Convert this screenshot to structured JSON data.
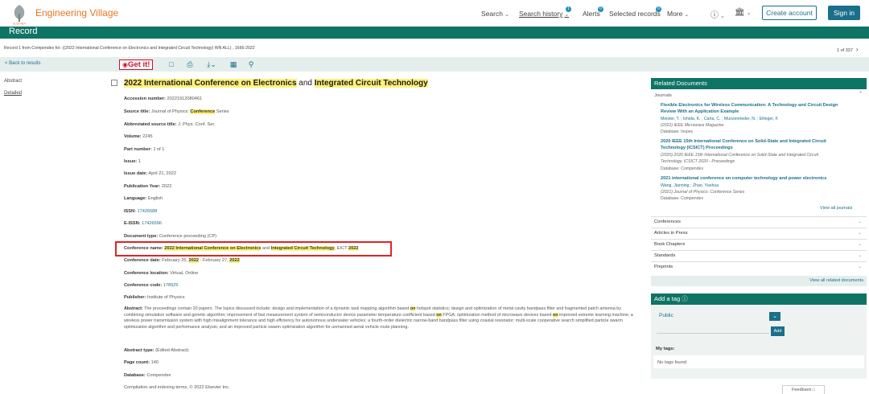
{
  "header": {
    "brand": "Engineering Village",
    "nav": [
      {
        "label": "Search"
      },
      {
        "label": "Search history",
        "badge": "1"
      },
      {
        "label": "Alerts",
        "badge": "0"
      },
      {
        "label": "Selected records",
        "badge": "0"
      },
      {
        "label": "More"
      }
    ],
    "create_account": "Create account",
    "sign_in": "Sign in"
  },
  "page": {
    "title": "Record",
    "record_line": "Record 1 from Compendex for: ((2022 International Conference on Electronics and Integrated Circuit Technology) WN ALL) , 1666-2022",
    "record_count": "1 of 337"
  },
  "toolbar": {
    "back": "< Back to results",
    "getit": "Get it!"
  },
  "sidenav": {
    "abstract": "Abstract",
    "detailed": "Detailed"
  },
  "record": {
    "title_a": "2022 International Conference on Electronics",
    "title_and": " and ",
    "title_b": "Integrated Circuit Technology",
    "accession_label": "Accession number:",
    "accession": "20221912080461",
    "source_label": "Source title:",
    "source_pre": "Journal of Physics: ",
    "source_hl": "Conference",
    "source_post": " Series",
    "abbrev_label": "Abbreviated source title:",
    "abbrev": "J. Phys. Conf. Ser.",
    "volume_label": "Volume:",
    "volume": "2245",
    "part_label": "Part number:",
    "part": "1 of 1",
    "issue_label": "Issue:",
    "issue": "1",
    "issue_date_label": "Issue date:",
    "issue_date": "April 21, 2022",
    "pub_year_label": "Publication Year:",
    "pub_year": "2022",
    "language_label": "Language:",
    "language": "English",
    "issn_label": "ISSN:",
    "issn": "17426588",
    "eissn_label": "E-ISSN:",
    "eissn": "17426596",
    "doctype_label": "Document type:",
    "doctype": "Conference proceeding (CP)",
    "confname_label": "Conference name:",
    "confname_a": "2022 International Conference on Electronics",
    "confname_and": " and ",
    "confname_b": "Integrated Circuit Technology",
    "confname_mid": ", EICT ",
    "confname_year": "2022",
    "confdate_label": "Conference date:",
    "confdate_a": "February 25, ",
    "confdate_y1": "2022",
    "confdate_b": " - February 27, ",
    "confdate_y2": "2022",
    "confloc_label": "Conference location:",
    "confloc": "Virtual, Online",
    "confcode_label": "Conference code:",
    "confcode": "178925",
    "publisher_label": "Publisher:",
    "publisher": "Institute of Physics",
    "abstract_label": "Abstract:",
    "abstract_1": " The proceedings contain 20 papers. The topics discussed include: design and implementation of a dynamic task mapping algorithm based ",
    "abstract_on1": "on",
    "abstract_2": " hotspot statistics; design and optimization of metal cavity bandpass filter and fragmented patch antenna by combining simulation software and genetic algorithm; improvement of fast measurement system of semiconductor device parameter temperature coefficient based ",
    "abstract_on2": "on",
    "abstract_3": " FPGA; optimization method of microwave devices based ",
    "abstract_on3": "on",
    "abstract_4": " improved extreme learning machine; a wireless power transmission system with high misalignment tolerance and high efficiency for autonomous underwater vehicles; a fourth-order dielectric narrow-band bandpass filter using coaxial resonator; multi-scale cooperative search simplified particle swarm optimization algorithm and performance analysis; and an improved particle swarm optimization algorithm for unmanned aerial vehicle route planning.",
    "abstract_type_label": "Abstract type:",
    "abstract_type": "(Edited Abstract)",
    "pagecount_label": "Page count:",
    "pagecount": "140",
    "database_label": "Database:",
    "database": "Compendex",
    "copyright": "Compilation and indexing terms, © 2022 Elsevier Inc."
  },
  "related": {
    "heading": "Related Documents",
    "journals_label": "Journals",
    "items": [
      {
        "title_1": "Flexible Electronics for Wireless Communication: A Technology and Circuit Design",
        "title_2": "Review With an Application Example",
        "authors": "Meister, T. ; Ishida, K. ; Carta, C. ; Munzenrieder, N. ; Ellinger, F.",
        "source": "(2022) IEEE Microwave Magazine",
        "database": "Database: Inspec"
      },
      {
        "title_1": "2020 IEEE 15th International Conference on Solid-State and Integrated Circuit",
        "title_2": "Technology (ICSICT) Proceedings",
        "source_1": "(2020) 2020 IEEE 15th International Conference on Solid-State and Integrated Circuit",
        "source_2": "Technology, ICSICT 2020 - Proceedings",
        "database": "Database: Compendex"
      },
      {
        "title_1": "2021 international conference on computer technology and power electronics",
        "authors": "Wang, Jianning ; Zhao, Yuehua",
        "source": "(2021) Journal of Physics: Conference Series",
        "database": "Database: Compendex"
      }
    ],
    "view_all_journals": "View all journals",
    "sections": [
      "Conferences",
      "Articles in Press",
      "Book Chapters",
      "Standards",
      "Preprints"
    ],
    "view_all_related": "View all related documents"
  },
  "tags": {
    "heading": "Add a tag",
    "visibility": "Public",
    "add": "Add",
    "my_tags": "My tags:",
    "none": "No tags found"
  },
  "feedback": "Feedback"
}
